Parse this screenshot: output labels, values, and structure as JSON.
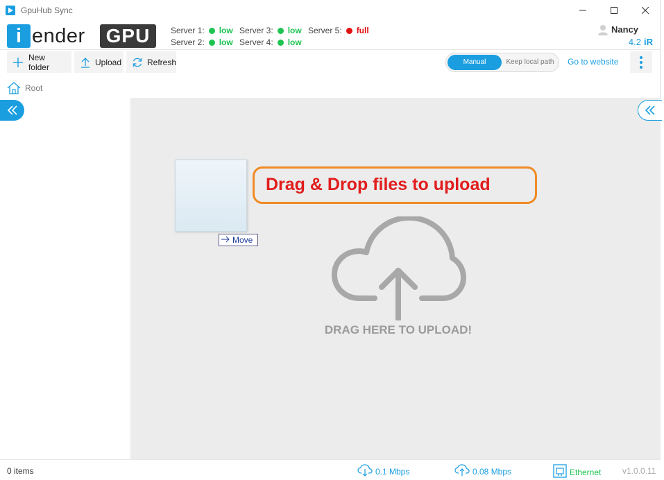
{
  "window": {
    "title": "GpuHub Sync",
    "controls": {
      "minimize": "—",
      "maximize": "☐",
      "close": "✕"
    }
  },
  "logo": {
    "i": "i",
    "ender": "Render",
    "gpu": "GPU"
  },
  "servers": [
    {
      "label": "Server 1:",
      "status": "low",
      "color": "#1ec451"
    },
    {
      "label": "Server 2:",
      "status": "low",
      "color": "#1ec451"
    },
    {
      "label": "Server 3:",
      "status": "low",
      "color": "#1ec451"
    },
    {
      "label": "Server 4:",
      "status": "low",
      "color": "#1ec451"
    },
    {
      "label": "Server 5:",
      "status": "full",
      "color": "#e31212"
    }
  ],
  "user": {
    "name": "Nancy",
    "credit": "4.2",
    "credit_icon": "iR"
  },
  "toolbar": {
    "new_folder": "New folder",
    "upload": "Upload",
    "refresh": "Refresh",
    "mode_manual": "Manual",
    "mode_keep": "Keep local path",
    "goto_website": "Go to website"
  },
  "breadcrumb": {
    "root": "Root"
  },
  "droparea": {
    "callout": "Drag & Drop files to upload",
    "move_tip": "Move",
    "label": "DRAG HERE TO UPLOAD!"
  },
  "statusbar": {
    "items": "0 items",
    "download_speed": "0.1 Mbps",
    "upload_speed": "0.08 Mbps",
    "network": "Ethernet",
    "version": "v1.0.0.11"
  },
  "colors": {
    "accent": "#1a9ee0",
    "ok": "#1ec451",
    "full": "#e31212",
    "callout_border": "#f08a24",
    "callout_text": "#e11d1d"
  }
}
